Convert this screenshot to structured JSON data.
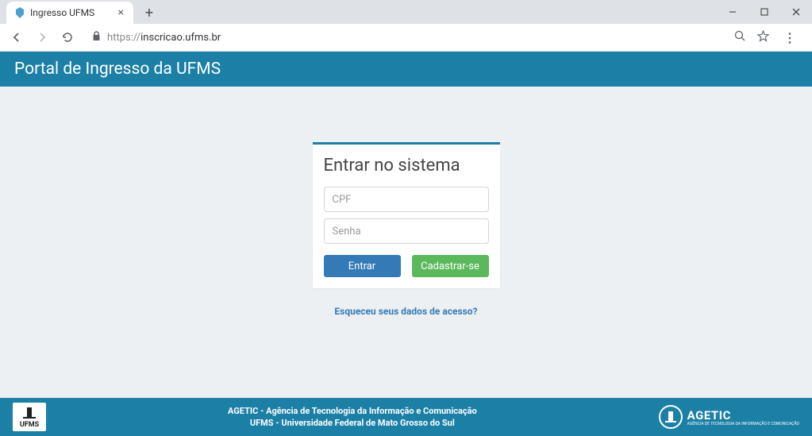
{
  "browser": {
    "tab_title": "Ingresso UFMS",
    "url_scheme": "https://",
    "url_host": "inscricao.ufms.br"
  },
  "header": {
    "title": "Portal de Ingresso da UFMS"
  },
  "login": {
    "title": "Entrar no sistema",
    "cpf_placeholder": "CPF",
    "senha_placeholder": "Senha",
    "entrar_label": "Entrar",
    "cadastrar_label": "Cadastrar-se",
    "forgot_label": "Esqueceu seus dados de acesso?"
  },
  "footer": {
    "left_logo_text": "UFMS",
    "line1": "AGETIC - Agência de Tecnologia da Informação e Comunicação",
    "line2": "UFMS - Universidade Federal de Mato Grosso do Sul",
    "right_logo_text": "AGETIC",
    "right_logo_sub": "AGÊNCIA DE TECNOLOGIA DA INFORMAÇÃO E COMUNICAÇÃO"
  }
}
